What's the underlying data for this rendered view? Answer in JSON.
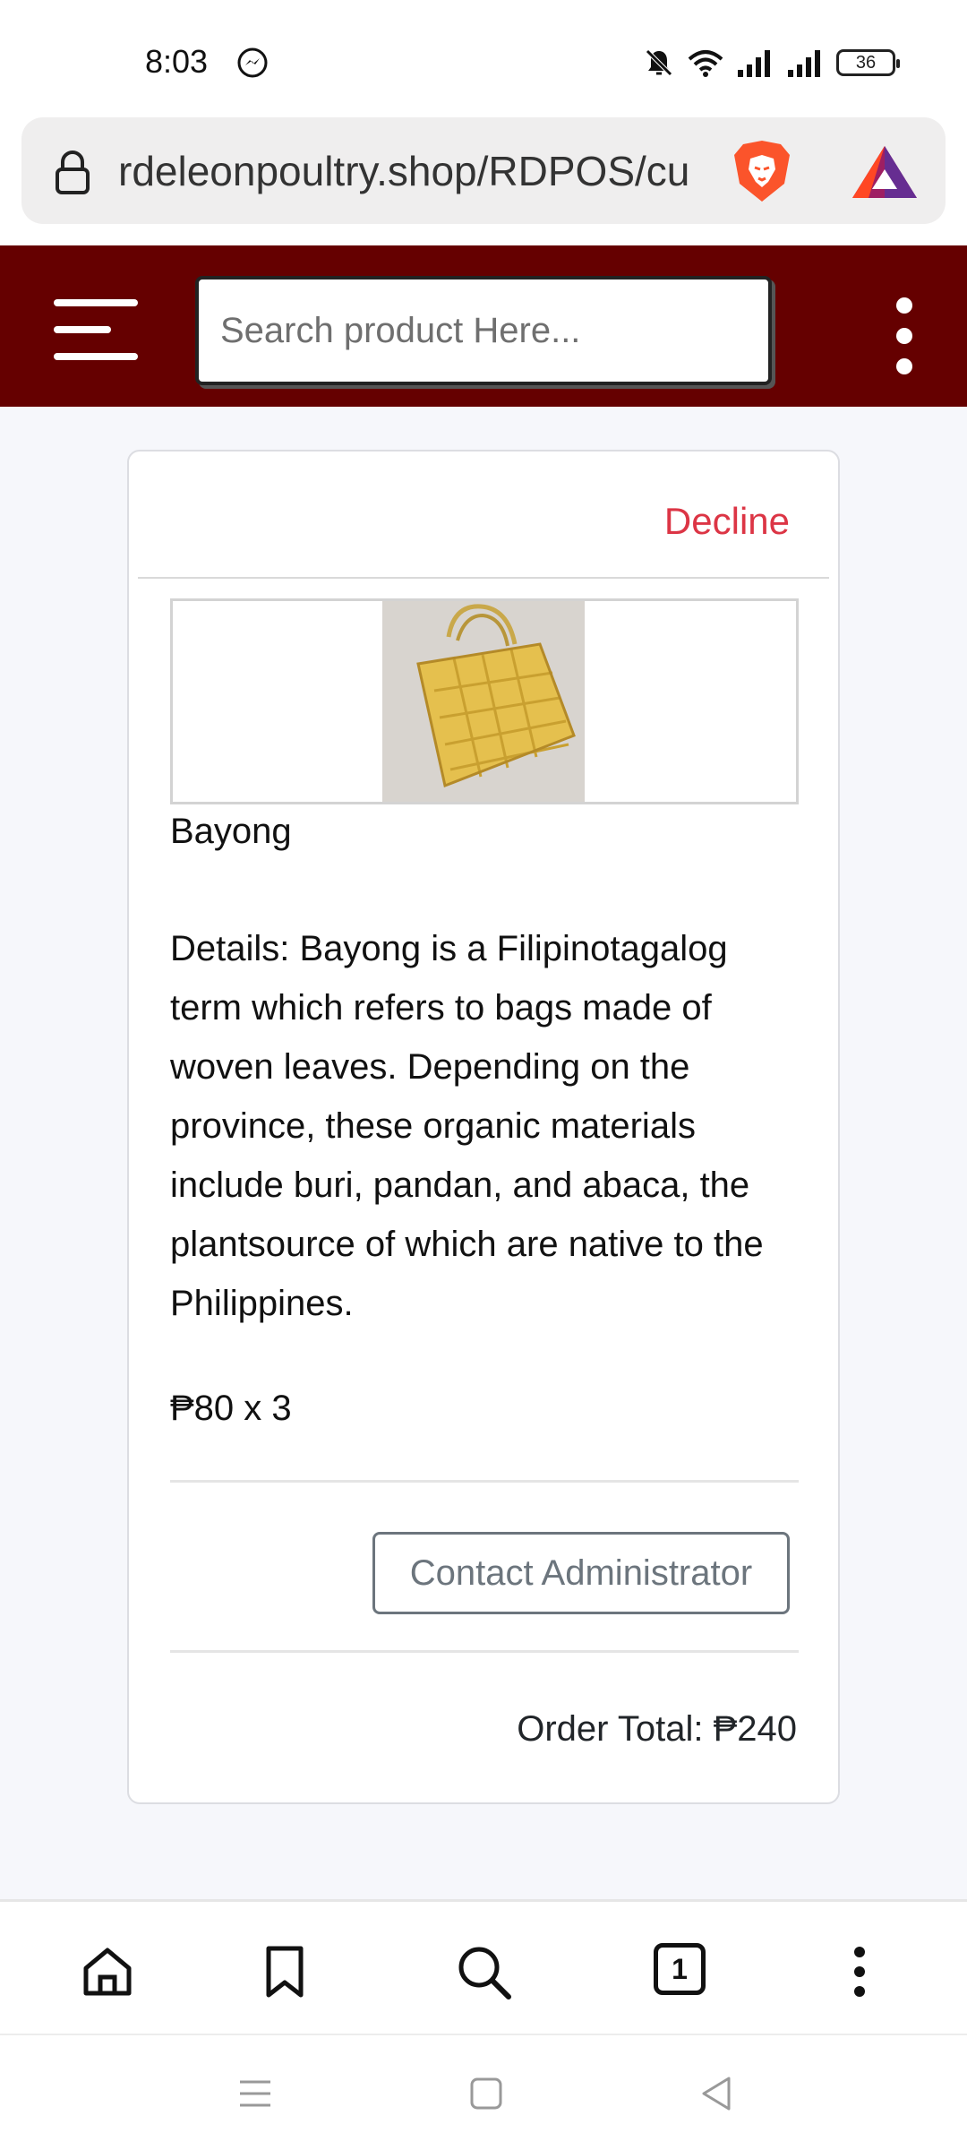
{
  "status_bar": {
    "time": "8:03",
    "battery": "36"
  },
  "browser": {
    "url": "rdeleonpoultry.shop/RDPOS/cu",
    "tab_count": "1"
  },
  "header": {
    "search_placeholder": "Search product Here...",
    "brand_color": "#650000"
  },
  "order": {
    "decline_label": "Decline",
    "product_name": "Bayong",
    "details": "Details: Bayong is a Filipinotagalog term which refers to bags made of woven leaves. Depending on the province, these organic materials include buri, pandan, and abaca, the plantsource of which are native to the Philippines.",
    "price_qty": "₱80 x 3",
    "contact_button": "Contact Administrator",
    "order_total": "Order Total: ₱240"
  },
  "colors": {
    "decline": "#dc3545",
    "button_outline": "#6c757d"
  }
}
